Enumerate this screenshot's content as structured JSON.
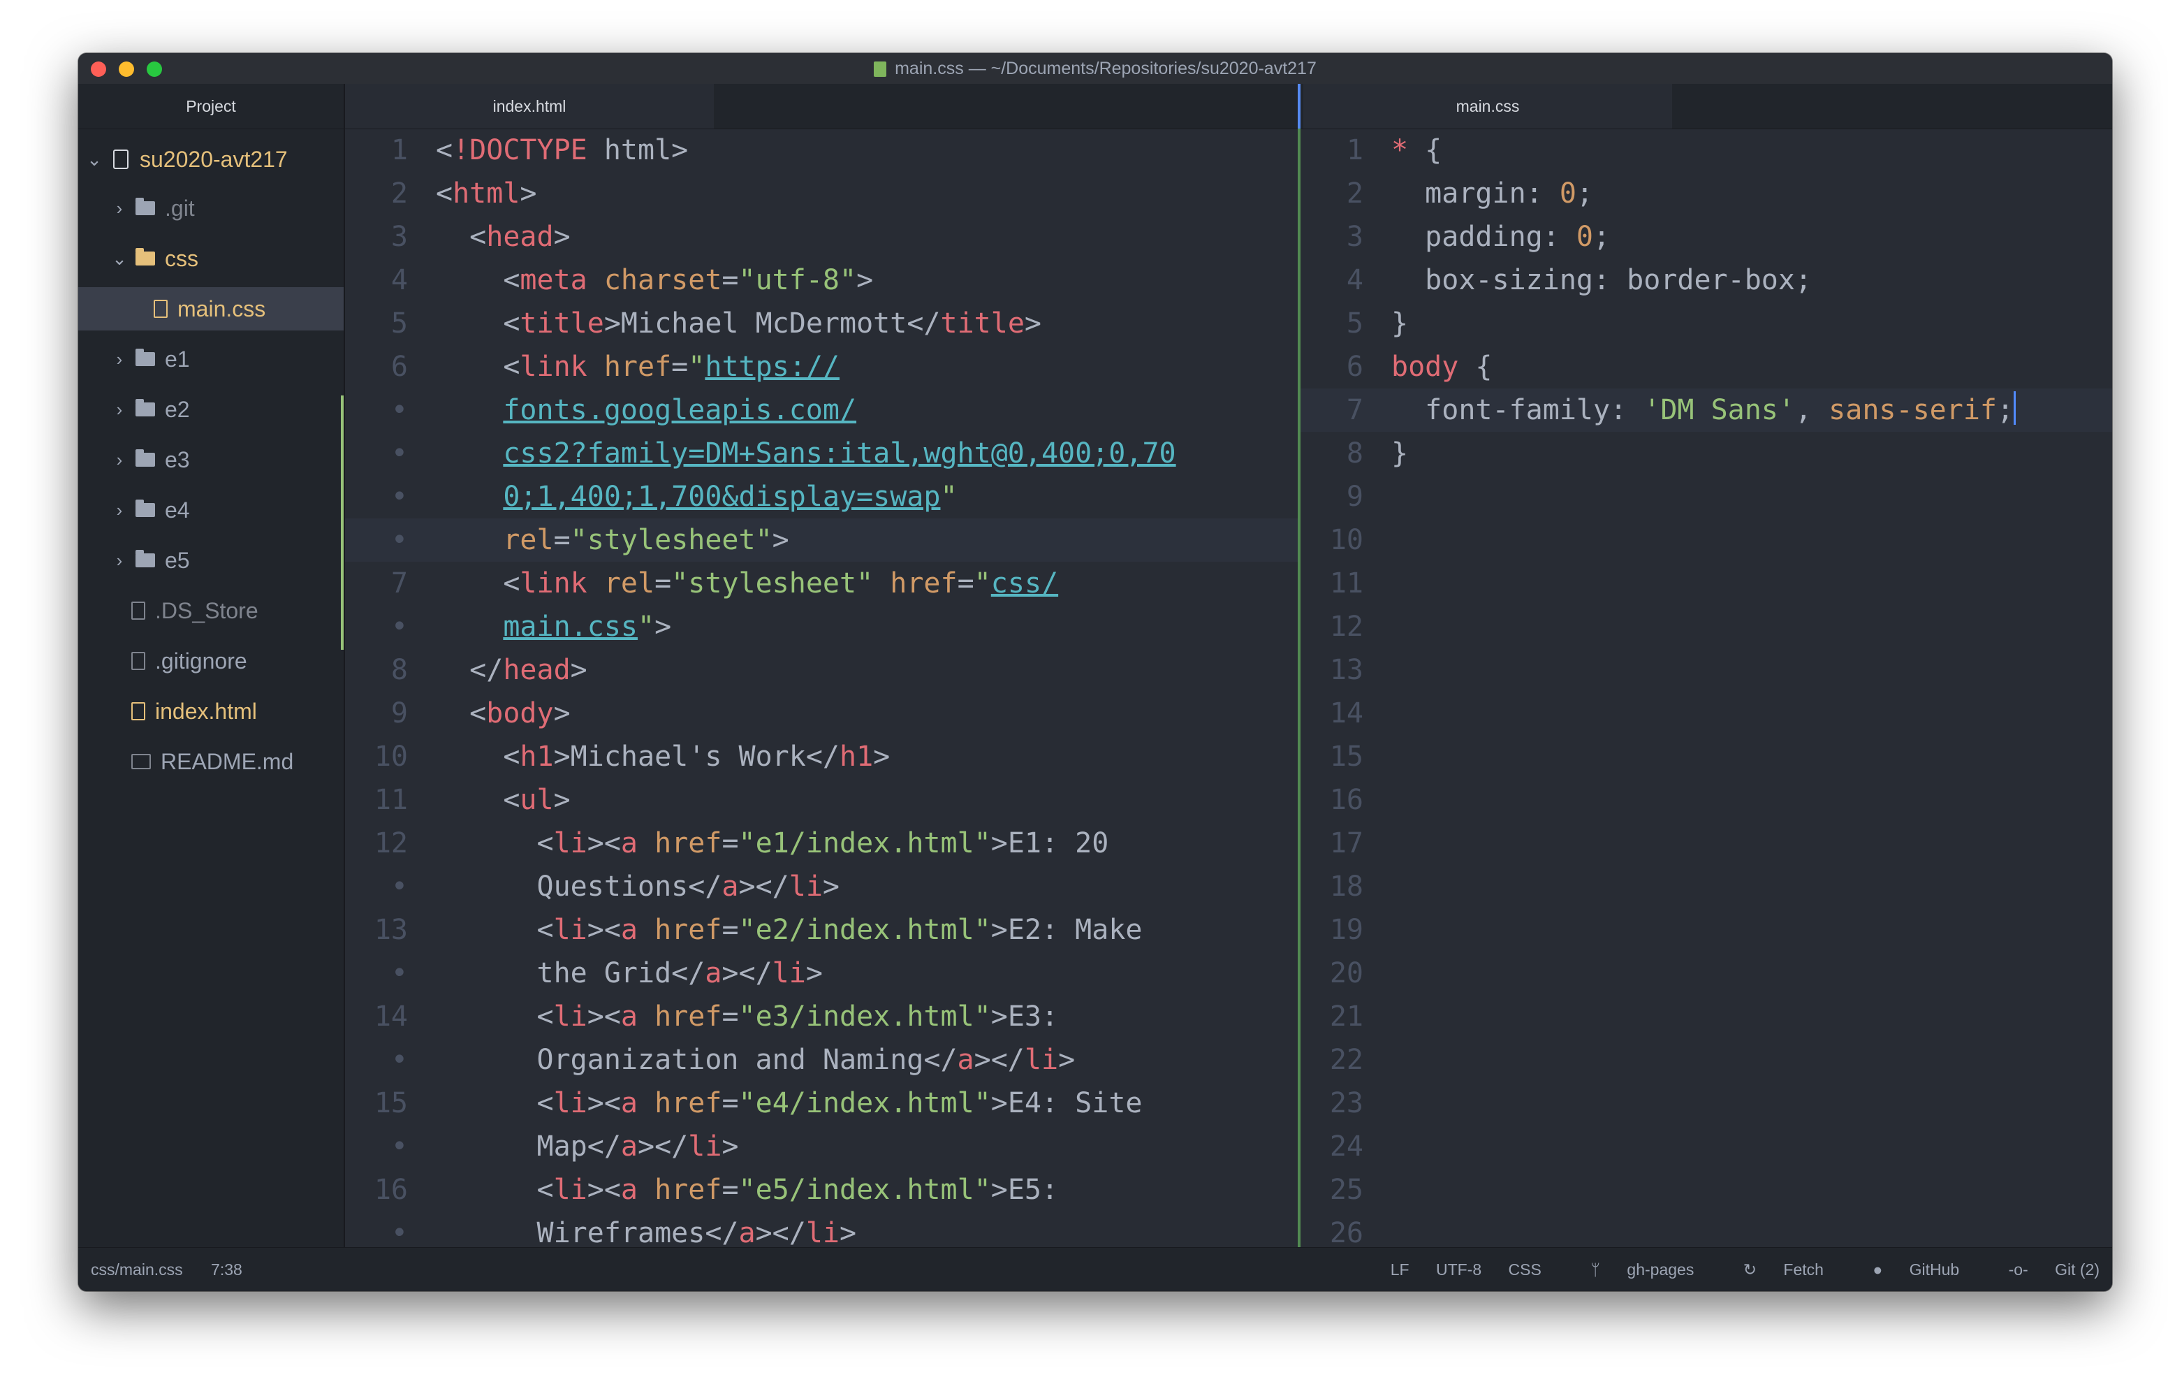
{
  "window": {
    "title": "main.css — ~/Documents/Repositories/su2020-avt217"
  },
  "sidebar": {
    "header": "Project",
    "root": "su2020-avt217",
    "items": [
      {
        "label": ".git",
        "type": "folder",
        "expanded": false
      },
      {
        "label": "css",
        "type": "folder",
        "expanded": true
      },
      {
        "label": "main.css",
        "type": "file",
        "selected": true
      },
      {
        "label": "e1",
        "type": "folder",
        "expanded": false
      },
      {
        "label": "e2",
        "type": "folder",
        "expanded": false
      },
      {
        "label": "e3",
        "type": "folder",
        "expanded": false
      },
      {
        "label": "e4",
        "type": "folder",
        "expanded": false
      },
      {
        "label": "e5",
        "type": "folder",
        "expanded": false
      },
      {
        "label": ".DS_Store",
        "type": "file"
      },
      {
        "label": ".gitignore",
        "type": "file"
      },
      {
        "label": "index.html",
        "type": "file",
        "modified": true
      },
      {
        "label": "README.md",
        "type": "file"
      }
    ]
  },
  "left_pane": {
    "tab": "index.html",
    "gutter": [
      "1",
      "2",
      "3",
      "4",
      "5",
      "6",
      "•",
      "•",
      "•",
      "•",
      "7",
      "•",
      "8",
      "9",
      "10",
      "11",
      "12",
      "•",
      "13",
      "•",
      "14",
      "•",
      "15",
      "•",
      "16",
      "•"
    ],
    "lines": [
      "<!DOCTYPE html>",
      "<html>",
      "  <head>",
      "    <meta charset=\"utf-8\">",
      "    <title>Michael McDermott</title>",
      "    <link href=\"https://",
      "    fonts.googleapis.com/",
      "    css2?family=DM+Sans:ital,wght@0,400;0,70",
      "    0;1,400;1,700&display=swap\"",
      "    rel=\"stylesheet\">",
      "    <link rel=\"stylesheet\" href=\"css/",
      "    main.css\">",
      "  </head>",
      "  <body>",
      "    <h1>Michael's Work</h1>",
      "    <ul>",
      "      <li><a href=\"e1/index.html\">E1: 20",
      "      Questions</a></li>",
      "      <li><a href=\"e2/index.html\">E2: Make",
      "      the Grid</a></li>",
      "      <li><a href=\"e3/index.html\">E3:",
      "      Organization and Naming</a></li>",
      "      <li><a href=\"e4/index.html\">E4: Site",
      "      Map</a></li>",
      "      <li><a href=\"e5/index.html\">E5:",
      "      Wireframes</a></li>"
    ]
  },
  "right_pane": {
    "tab": "main.css",
    "gutter": [
      "1",
      "2",
      "3",
      "4",
      "5",
      "6",
      "7",
      "8",
      "9",
      "10",
      "11",
      "12",
      "13",
      "14",
      "15",
      "16",
      "17",
      "18",
      "19",
      "20",
      "21",
      "22",
      "23",
      "24",
      "25",
      "26"
    ],
    "lines": [
      "* {",
      "  margin: 0;",
      "  padding: 0;",
      "  box-sizing: border-box;",
      "}",
      "body {",
      "  font-family: 'DM Sans', sans-serif;",
      "}"
    ]
  },
  "status_bar": {
    "file_path": "css/main.css",
    "cursor_position": "7:38",
    "line_ending": "LF",
    "encoding": "UTF-8",
    "grammar": "CSS",
    "branch": "gh-pages",
    "fetch": "Fetch",
    "github": "GitHub",
    "git": "Git (2)"
  },
  "colors": {
    "background": "#282c34",
    "sidebar": "#21252b",
    "tag": "#e06c75",
    "attribute": "#d19a66",
    "string": "#98c379",
    "link": "#56b6c2",
    "accent": "#568af2"
  }
}
